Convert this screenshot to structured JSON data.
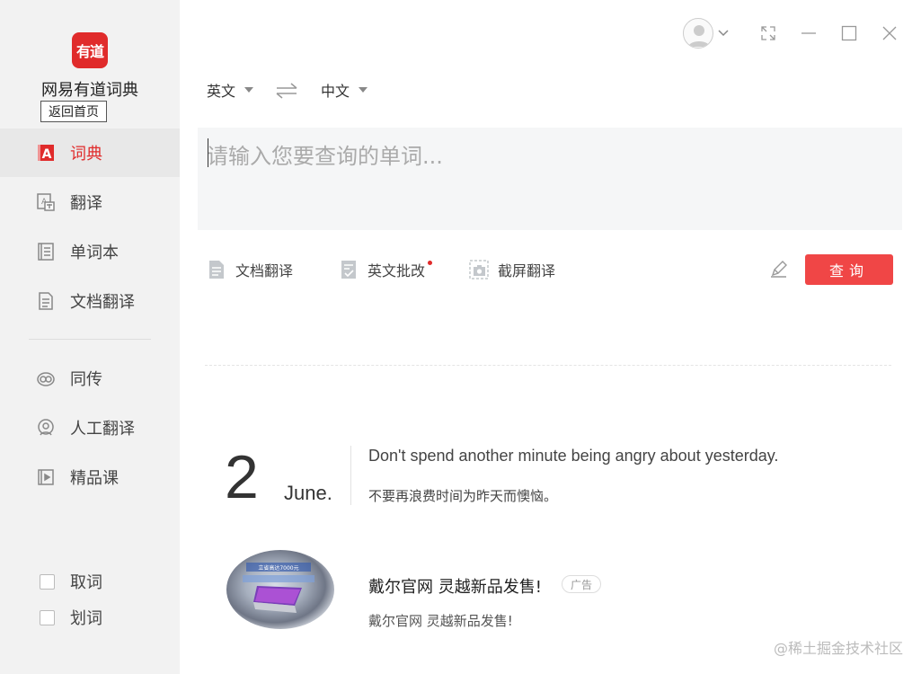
{
  "app": {
    "logo_text": "有道",
    "name": "网易有道词典",
    "home_button": "返回首页"
  },
  "sidebar": {
    "items": [
      {
        "label": "词典",
        "icon": "dictionary-icon",
        "active": true
      },
      {
        "label": "翻译",
        "icon": "translate-icon",
        "active": false
      },
      {
        "label": "单词本",
        "icon": "wordbook-icon",
        "active": false
      },
      {
        "label": "文档翻译",
        "icon": "document-icon",
        "active": false
      },
      {
        "label": "同传",
        "icon": "simultaneous-icon",
        "active": false
      },
      {
        "label": "人工翻译",
        "icon": "human-translate-icon",
        "active": false
      },
      {
        "label": "精品课",
        "icon": "course-play-icon",
        "active": false
      }
    ],
    "checks": [
      {
        "label": "取词",
        "checked": false
      },
      {
        "label": "划词",
        "checked": false
      }
    ]
  },
  "lang": {
    "source": "英文",
    "target": "中文"
  },
  "search": {
    "placeholder": "请输入您要查询的单词..."
  },
  "tools": [
    {
      "label": "文档翻译",
      "icon": "document-icon"
    },
    {
      "label": "英文批改",
      "icon": "checklist-icon"
    },
    {
      "label": "截屏翻译",
      "icon": "screenshot-camera-icon"
    }
  ],
  "query_button": "查询",
  "daily": {
    "day": "2",
    "month": "June.",
    "quote_en": "Don't spend another minute being angry about yesterday.",
    "quote_zh": "不要再浪费时间为昨天而懊恼。"
  },
  "ad": {
    "title": "戴尔官网 灵越新品发售!",
    "badge": "广告",
    "subtitle": "戴尔官网 灵越新品发售!",
    "image_text": "立省高达7000元"
  },
  "watermark": "@稀土掘金技术社区",
  "colors": {
    "accent": "#e02b2b",
    "button": "#f04646",
    "sidebar_bg": "#f2f2f2",
    "input_bg": "#f5f6f7"
  }
}
